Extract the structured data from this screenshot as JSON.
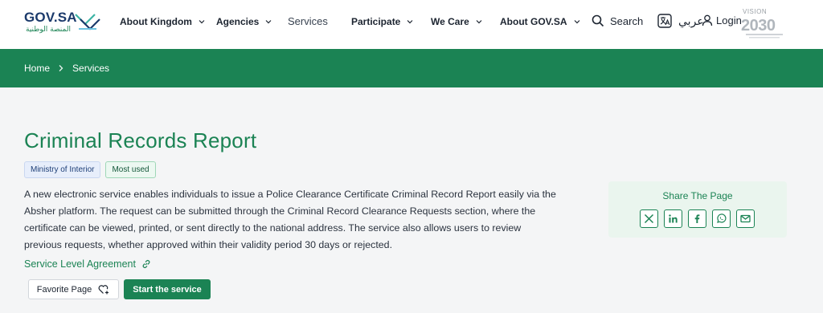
{
  "header": {
    "logo_text": "GOV.SA",
    "logo_subtitle": "المنصة الوطنية",
    "nav": [
      {
        "label": "About Kingdom",
        "has_menu": true
      },
      {
        "label": "Agencies",
        "has_menu": true
      },
      {
        "label": "Services",
        "has_menu": false
      },
      {
        "label": "Participate",
        "has_menu": true
      },
      {
        "label": "We Care",
        "has_menu": true
      },
      {
        "label": "About GOV.SA",
        "has_menu": true
      }
    ],
    "search_label": "Search",
    "language_label": "عربي",
    "login_label": "Login",
    "vision_text": "VISION",
    "vision_year": "2030"
  },
  "breadcrumb": {
    "home": "Home",
    "current": "Services"
  },
  "main": {
    "title": "Criminal Records Report",
    "badges": [
      "Ministry of Interior",
      "Most used"
    ],
    "description": "A new electronic service enables individuals to issue a Police Clearance Certificate Criminal Record Report easily via the Absher platform. The request can be submitted through the Criminal Record Clearance Requests section, where the certificate can be viewed, printed, or sent directly to the national address. The service also allows users to review previous requests, whether approved within their validity period 30 days or rejected.",
    "sla_label": "Service Level Agreement",
    "favorite_label": "Favorite Page",
    "start_label": "Start the service"
  },
  "share": {
    "title": "Share The Page",
    "icons": [
      "x-icon",
      "linkedin-icon",
      "facebook-icon",
      "whatsapp-icon",
      "email-icon"
    ]
  },
  "colors": {
    "brand_green": "#1b8354",
    "navy": "#1b3a6b",
    "background": "#f4f5f6"
  }
}
